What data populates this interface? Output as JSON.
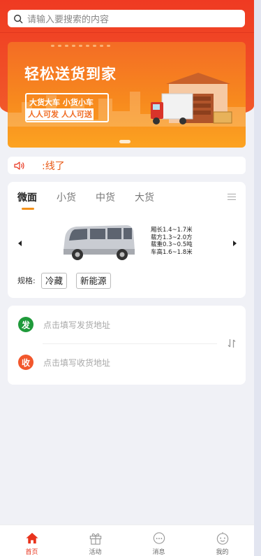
{
  "search": {
    "placeholder": "请输入要搜索的内容"
  },
  "banner": {
    "title": "轻松送货到家",
    "line1": "大货大车 小货小车",
    "line2": "人人可发 人人可送"
  },
  "notice": {
    "text": ":线了"
  },
  "vehicle": {
    "tabs": [
      "微面",
      "小货",
      "中货",
      "大货"
    ],
    "active_tab": "微面",
    "specs": [
      "厢长1.4~1.7米",
      "载方1.3~2.0方",
      "载重0.3~0.5吨",
      "车高1.6~1.8米"
    ],
    "spec_label": "规格:",
    "options": [
      "冷藏",
      "新能源"
    ]
  },
  "address": {
    "send_badge": "发",
    "send_hint": "点击填写发货地址",
    "receive_badge": "收",
    "receive_hint": "点击填写收货地址"
  },
  "nav": {
    "items": [
      "首页",
      "活动",
      "消息",
      "我的"
    ],
    "active": "首页"
  },
  "colors": {
    "brand": "#ef3a22",
    "accent": "#f39119",
    "send": "#1f9a3a",
    "receive": "#f2572c"
  }
}
